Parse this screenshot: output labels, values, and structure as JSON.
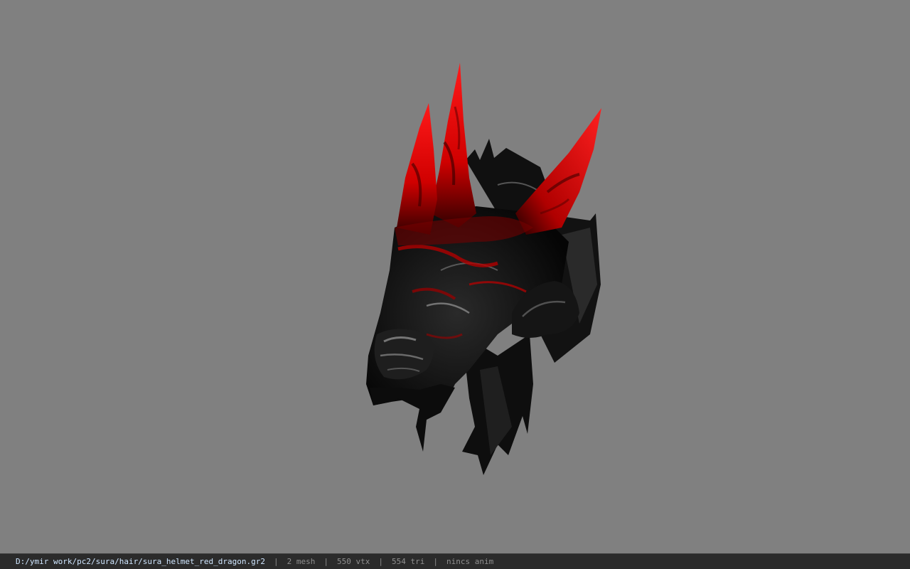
{
  "viewer": {
    "background_color": "#808080",
    "model_icon": "dragon-helmet-model",
    "model_colors": {
      "dark": "#0a0a0a",
      "mid": "#1c1c1c",
      "highlight": "#9a9a9a",
      "red": "#e00000",
      "dark_red": "#7a0000"
    }
  },
  "status_bar": {
    "file_path": "D:/ymir work/pc2/sura/hair/sura_helmet_red_dragon.gr2",
    "separator": "|",
    "mesh": "2 mesh",
    "vertices": "550 vtx",
    "triangles": "554 tri",
    "animation": "nincs anim"
  }
}
